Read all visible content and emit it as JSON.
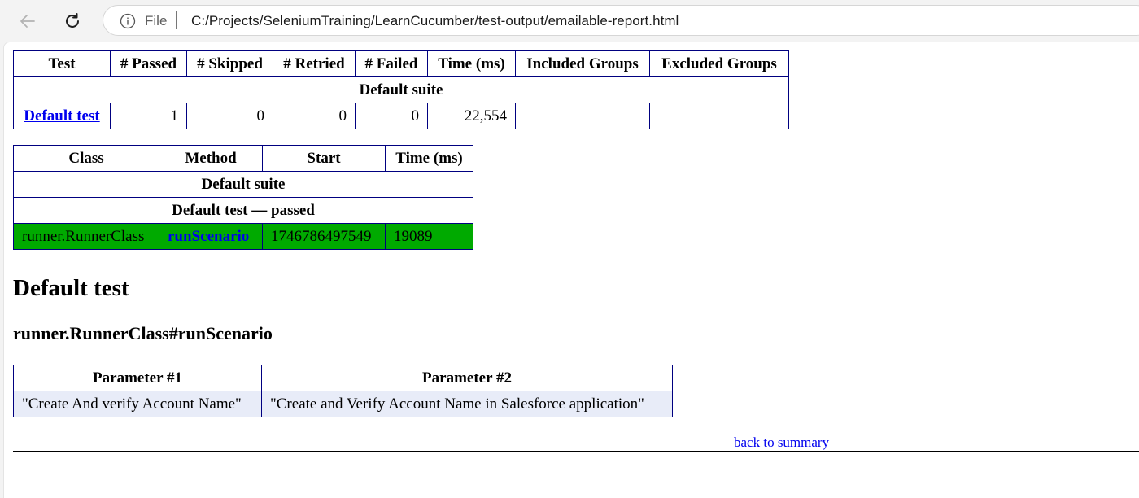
{
  "browser": {
    "scheme_label": "File",
    "url": "C:/Projects/SeleniumTraining/LearnCucumber/test-output/emailable-report.html"
  },
  "summary": {
    "headers": [
      "Test",
      "# Passed",
      "# Skipped",
      "# Retried",
      "# Failed",
      "Time (ms)",
      "Included Groups",
      "Excluded Groups"
    ],
    "suite_label": "Default suite",
    "row": {
      "test": "Default test",
      "passed": "1",
      "skipped": "0",
      "retried": "0",
      "failed": "0",
      "time_ms": "22,554",
      "included_groups": "",
      "excluded_groups": ""
    }
  },
  "methods": {
    "headers": [
      "Class",
      "Method",
      "Start",
      "Time (ms)"
    ],
    "suite_label": "Default suite",
    "test_status_label": "Default test — passed",
    "row": {
      "class": "runner.RunnerClass",
      "method": "runScenario",
      "start": "1746786497549",
      "time_ms": "19089"
    },
    "passed_color": "#00aa00"
  },
  "detail": {
    "test_heading": "Default test",
    "method_heading": "runner.RunnerClass#runScenario",
    "param_headers": [
      "Parameter #1",
      "Parameter #2"
    ],
    "param_values": [
      "\"Create And verify Account Name\"",
      "\"Create and Verify Account Name in Salesforce application\""
    ],
    "back_link": "back to summary"
  }
}
